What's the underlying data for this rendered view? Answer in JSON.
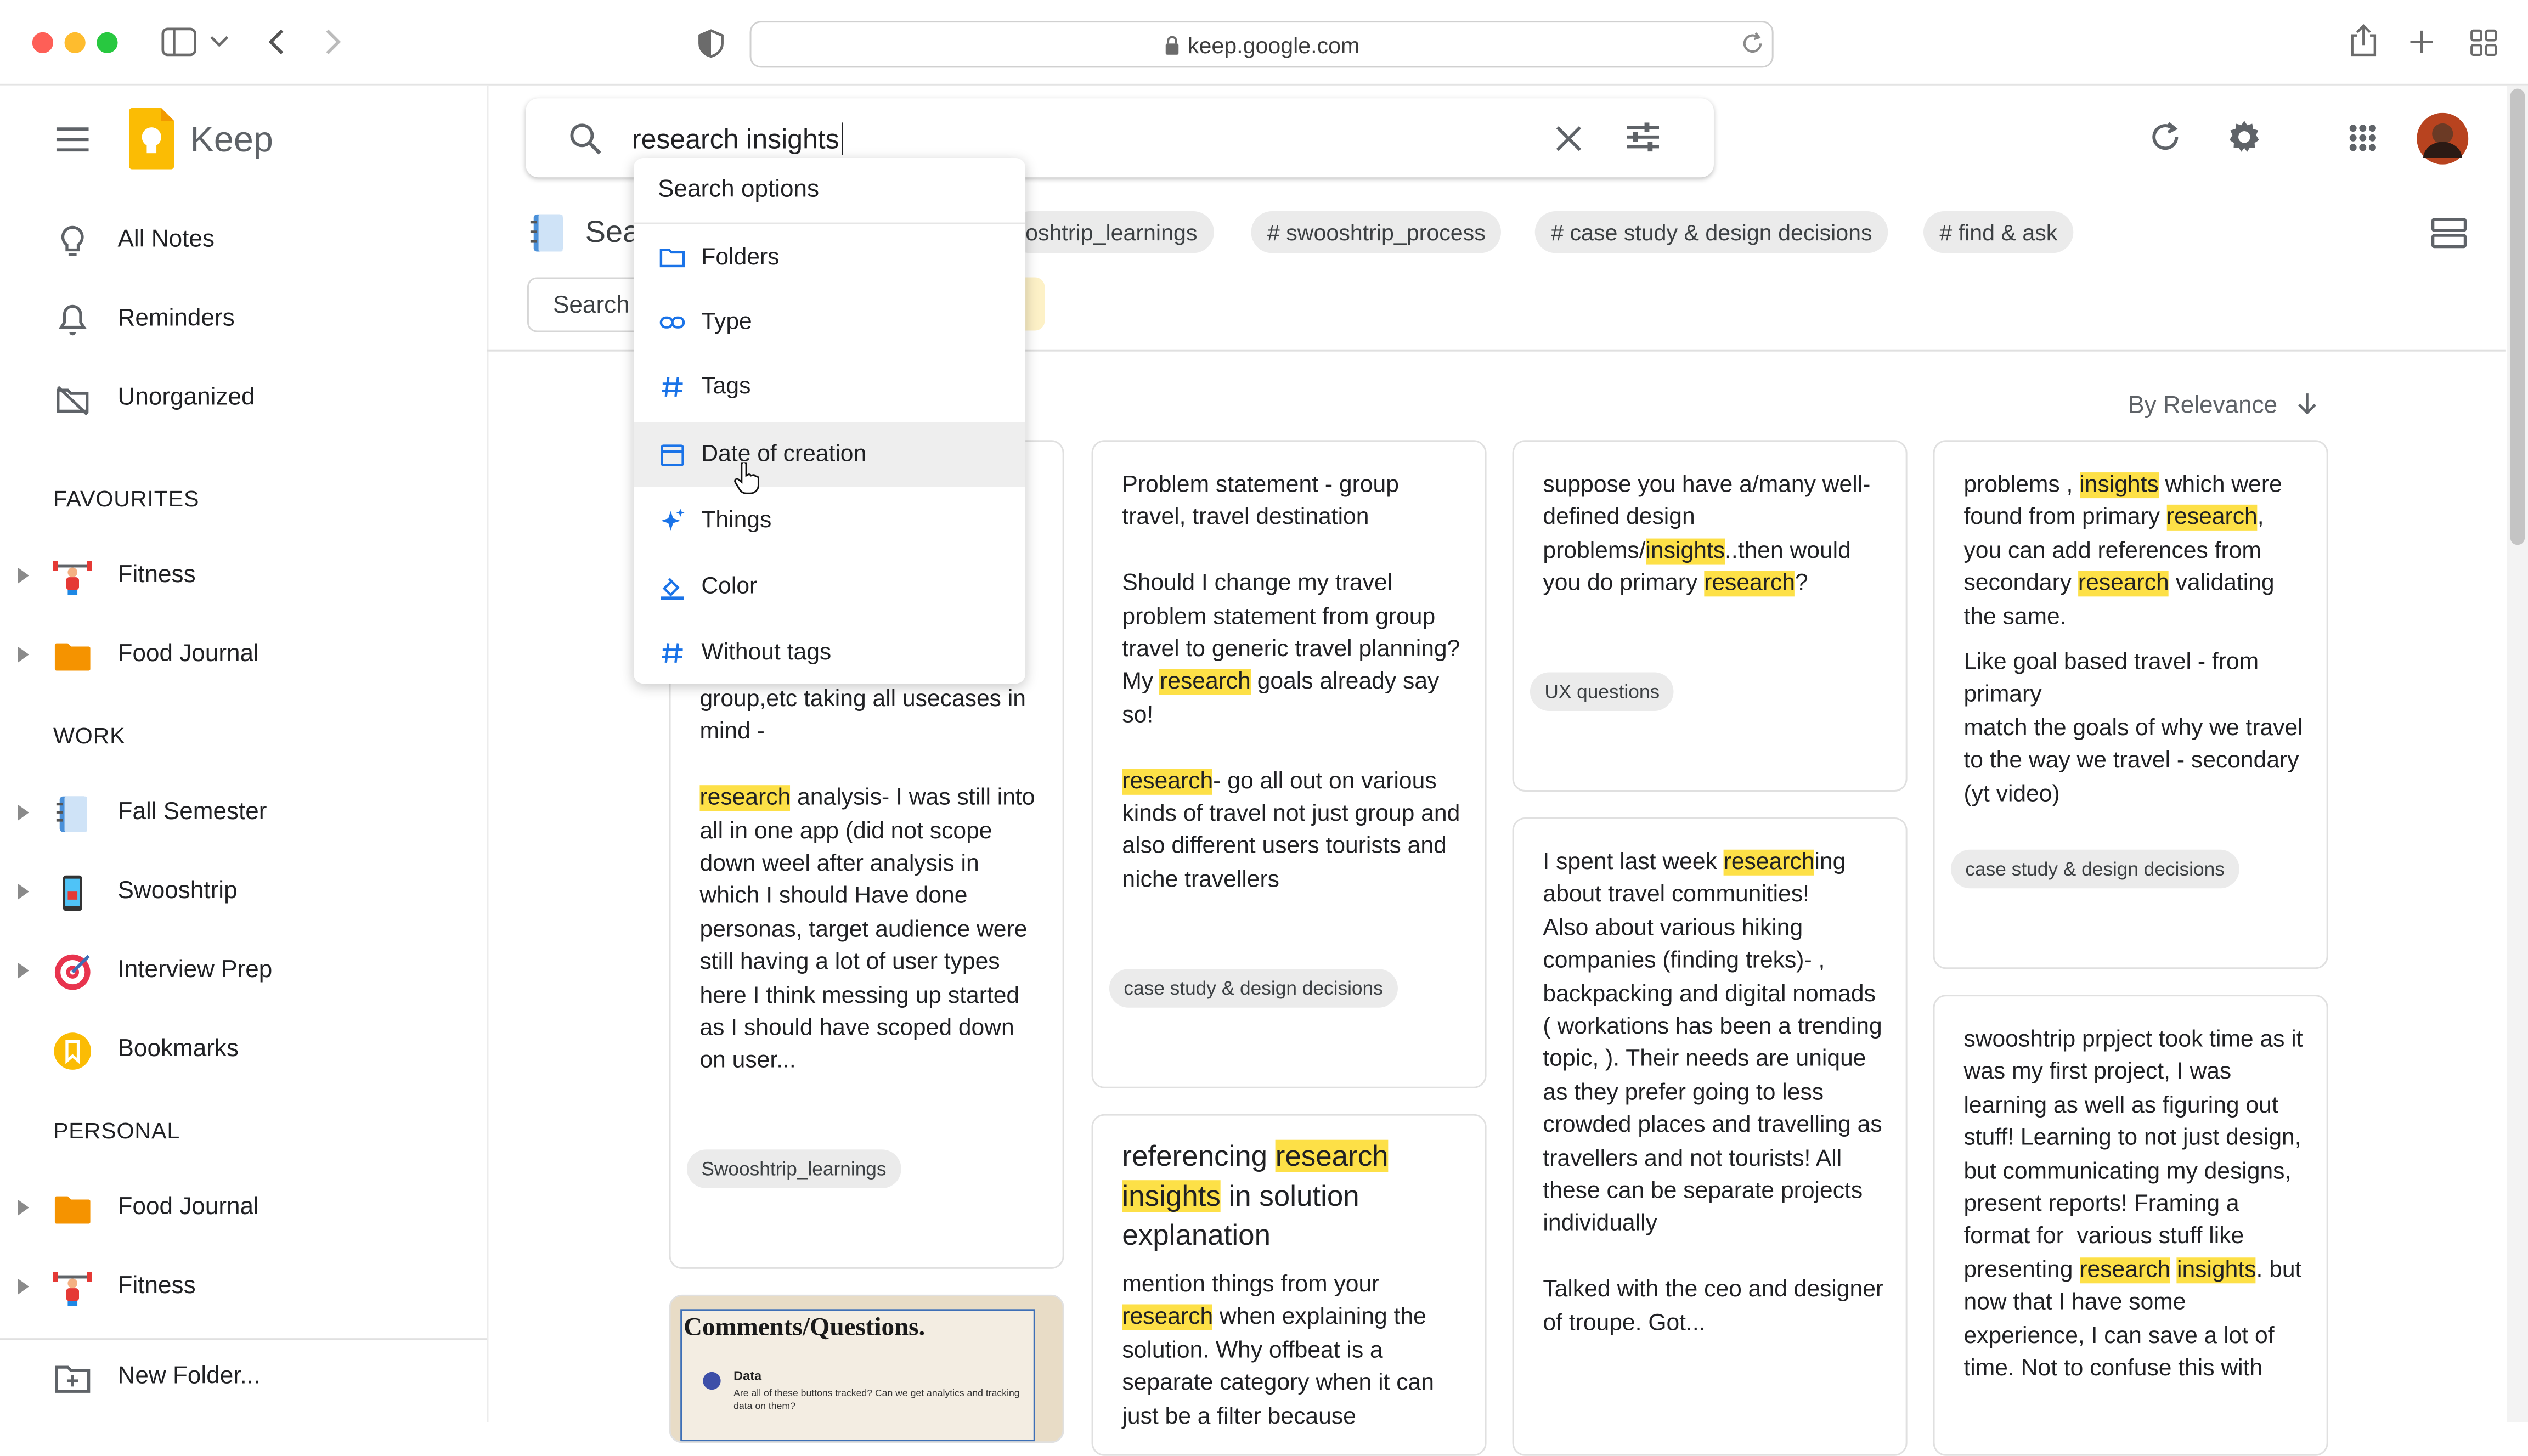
{
  "browser": {
    "url": "keep.google.com"
  },
  "app": {
    "name": "Keep"
  },
  "sidebar": {
    "items": [
      {
        "label": "All Notes"
      },
      {
        "label": "Reminders"
      },
      {
        "label": "Unorganized"
      }
    ],
    "sections": {
      "favourites": {
        "title": "FAVOURITES",
        "items": [
          {
            "label": "Fitness"
          },
          {
            "label": "Food Journal"
          }
        ]
      },
      "work": {
        "title": "WORK",
        "items": [
          {
            "label": "Fall Semester"
          },
          {
            "label": "Swooshtrip"
          },
          {
            "label": "Interview Prep"
          },
          {
            "label": "Bookmarks"
          }
        ]
      },
      "personal": {
        "title": "PERSONAL",
        "items": [
          {
            "label": "Food Journal"
          },
          {
            "label": "Fitness"
          }
        ]
      }
    },
    "new_folder": "New Folder..."
  },
  "search": {
    "query": "research insights"
  },
  "header": {
    "partial_title": "Sea",
    "search_tab": "Search",
    "chips": [
      "oshtrip_learnings",
      "# swooshtrip_process",
      "# case study & design decisions",
      "# find & ask"
    ]
  },
  "dropdown": {
    "title": "Search options",
    "items": [
      {
        "label": "Folders",
        "icon": "folder-icon"
      },
      {
        "label": "Type",
        "icon": "link-icon"
      },
      {
        "label": "Tags",
        "icon": "hash-icon"
      },
      {
        "label": "Date of creation",
        "icon": "calendar-icon"
      },
      {
        "label": "Things",
        "icon": "sparkle-icon"
      },
      {
        "label": "Color",
        "icon": "color-fill-icon"
      },
      {
        "label": "Without tags",
        "icon": "hash-icon"
      }
    ]
  },
  "sort": {
    "label": "By Relevance"
  },
  "cards": {
    "c1": {
      "text": "group,etc taking all usecases in mind -",
      "hl_word": "research",
      "text2": " analysis- I was still into all in one app (did not scope down weel after analysis in which I should Have done  personas, target audience were still having a lot of user types here I think messing up started as I should have scoped down on user...",
      "label": "Swooshtrip_learnings"
    },
    "c2": {
      "line1": "Problem statement - group travel, travel destination",
      "line2a": "Should I change my travel problem statement from group travel to generic travel planning? My ",
      "hl1": "research",
      "line2b": " goals already say so!",
      "hl2": "research",
      "line3": "- go all out on various kinds of travel not just group and also different users tourists and niche travellers",
      "label": "case study & design decisions"
    },
    "c3": {
      "a": "suppose you have a/many well-defined design problems/",
      "hl1": "insights",
      "b": "..then would you do primary ",
      "hl2": "research",
      "c": "?",
      "label": "UX questions"
    },
    "c4": {
      "a": "problems , ",
      "hl1": "insights",
      "b": " which were found from primary ",
      "hl2": "research",
      "c": ", you can add references from secondary ",
      "hl3": "research",
      "d": " validating the same.",
      "e": "Like goal based travel - from primary\nmatch the goals of why we travel to the way we travel - secondary (yt video)",
      "label": "case study & design decisions"
    },
    "c5": {
      "title_a": "referencing ",
      "title_hl1": "research",
      "title_hl2": "insights",
      "title_b": " in solution explanation",
      "a": "mention things from your ",
      "hl": "research",
      "b": " when explaining the solution. Why offbeat is a separate category when it can just be a filter because"
    },
    "c6": {
      "a": "I spent last week ",
      "hl": "research",
      "b": "ing about travel communities!\nAlso about various hiking companies (finding treks)- , backpacking and digital nomads ( workations has been a trending topic, ). Their needs are unique as they prefer going to less crowded places and travelling as travellers and not tourists! All these can be separate projects individually\n\nTalked with the ceo and designer of troupe. Got..."
    },
    "c7": {
      "a": "swooshtrip prpject took time as it was my first project, I was learning as well as figuring out stuff! Learning to not just design, but communicating my designs, present reports! Framing a format for  various stuff like presenting ",
      "hl1": "research",
      "hl2": "insights",
      "b": ". but now that I have some experience, I can save a lot of time. Not to confuse this with"
    },
    "c8": {
      "title": "Comments/Questions.",
      "item_title": "Data",
      "item_text": "Are all of these buttons tracked? Can we get analytics and tracking data on them?"
    }
  }
}
